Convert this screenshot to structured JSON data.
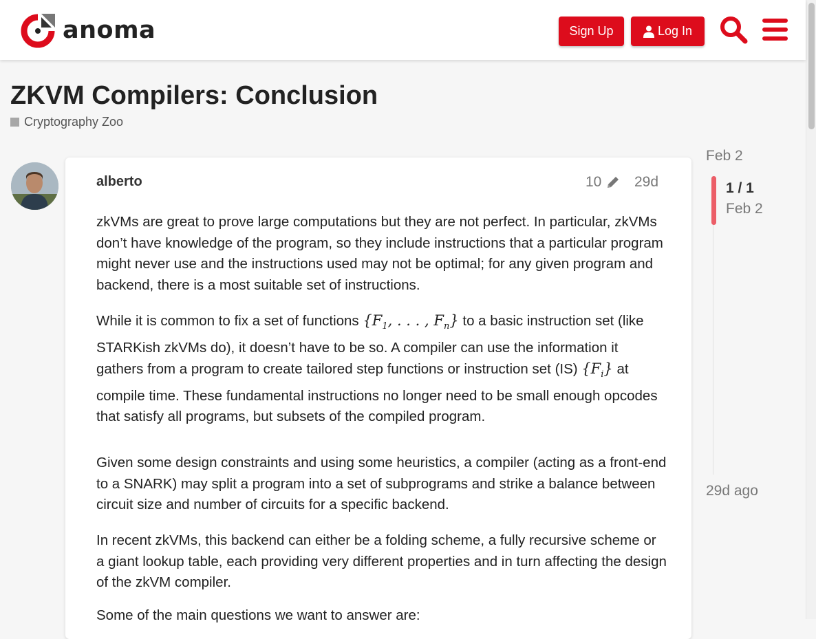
{
  "header": {
    "logo_text": "anoma",
    "signup_label": "Sign Up",
    "login_label": "Log In",
    "accent_color": "#dd0c1c"
  },
  "topic": {
    "title": "ZKVM Compilers: Conclusion",
    "category": "Cryptography Zoo"
  },
  "post": {
    "author": "alberto",
    "edit_count": "10",
    "age": "29d",
    "paragraphs": [
      "zkVMs are great to prove large computations but they are not perfect. In particular, zkVMs don’t have knowledge of the program, so they include instructions that a particular program might never use and the instructions used may not be optimal; for any given program and backend, there is a most suitable set of instructions.",
      "While it is common to fix a set of functions",
      "to a basic instruction set (like STARKish zkVMs do), it doesn’t have to be so. A compiler can use the information it gathers from a program to create tailored step functions or instruction set (IS)",
      "at compile time. These fundamental instructions no longer need to be small enough opcodes that satisfy all programs, but subsets of the compiled program.",
      "Given some design constraints and using some heuristics, a compiler (acting as a front-end to a SNARK) may split a program into a set of subprograms and strike a balance between circuit size and number of circuits for a specific backend.",
      "In recent zkVMs, this backend can either be a folding scheme, a fully recursive scheme or a giant lookup table, each providing very different properties and in turn affecting the design of the zkVM compiler.",
      "Some of the main questions we want to answer are:"
    ]
  },
  "timeline": {
    "top_date": "Feb 2",
    "count": "1 / 1",
    "current_date": "Feb 2",
    "bottom_label": "29d ago"
  }
}
